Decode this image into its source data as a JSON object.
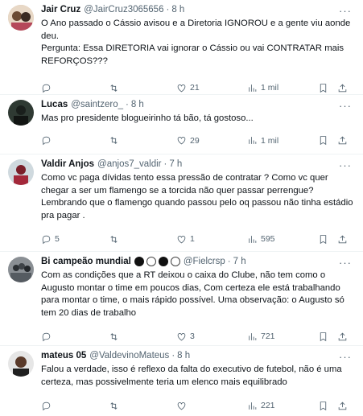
{
  "tweets": [
    {
      "name": "Jair Cruz",
      "handle": "@JairCruz3065656",
      "time": "8 h",
      "text": "O Ano passado o Cássio avisou e a Diretoria IGNOROU e a gente viu aonde deu.\nPergunta: Essa DIRETORIA vai ignorar o Cássio ou vai CONTRATAR mais REFORÇOS???",
      "replies": "",
      "retweets": "",
      "likes": "21",
      "views": "1 mil"
    },
    {
      "name": "Lucas",
      "handle": "@saintzero_",
      "time": "8 h",
      "text": "Mas pro presidente blogueirinho tá bão, tá gostoso...",
      "replies": "",
      "retweets": "",
      "likes": "29",
      "views": "1 mil"
    },
    {
      "name": "Valdir Anjos",
      "handle": "@anjos7_valdir",
      "time": "7 h",
      "text": "Como vc paga dívidas tento essa pressão de contratar ? Como vc quer chegar a ser um flamengo se a torcida não quer passar perrengue? Lembrando que o flamengo quando passou pelo oq passou não tinha estádio pra pagar .",
      "replies": "5",
      "retweets": "",
      "likes": "1",
      "views": "595"
    },
    {
      "name": "Bi campeão mundial",
      "handle": "@Fielcrsp",
      "time": "7 h",
      "text": "Com as condições que a RT deixou o caixa do Clube, não tem como o Augusto montar o time em poucos dias, Com certeza ele está trabalhando para montar o time, o mais rápido possível. Uma observação: o Augusto só tem 20 dias de trabalho",
      "replies": "",
      "retweets": "",
      "likes": "3",
      "views": "721"
    },
    {
      "name": "mateus 05",
      "handle": "@ValdevinoMateus",
      "time": "8 h",
      "text": "Falou a verdade, isso é reflexo da falta do executivo de futebol, não é uma certeza, mas possivelmente teria um elenco mais equilibrado",
      "replies": "",
      "retweets": "",
      "likes": "",
      "views": "221"
    }
  ],
  "ui": {
    "separator": "·",
    "more": "···"
  },
  "colors": {
    "text": "#0f1419",
    "secondary": "#536471",
    "border": "#eff3f4"
  },
  "icons": [
    "reply-icon",
    "retweet-icon",
    "like-icon",
    "views-icon",
    "bookmark-icon",
    "share-icon",
    "more-icon"
  ]
}
